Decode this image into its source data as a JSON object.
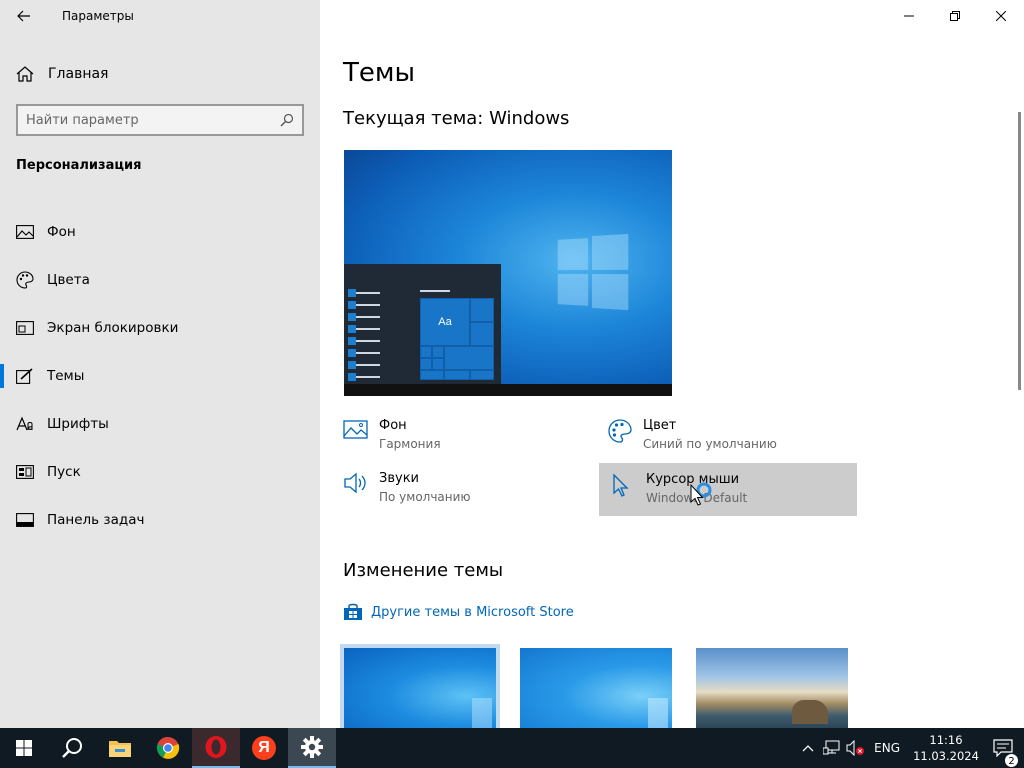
{
  "window": {
    "title": "Параметры"
  },
  "sidebar": {
    "home_label": "Главная",
    "search_placeholder": "Найти параметр",
    "section_heading": "Персонализация",
    "items": [
      {
        "label": "Фон",
        "icon": "picture-icon"
      },
      {
        "label": "Цвета",
        "icon": "palette-icon"
      },
      {
        "label": "Экран блокировки",
        "icon": "lock-screen-icon"
      },
      {
        "label": "Темы",
        "icon": "brush-icon",
        "active": true
      },
      {
        "label": "Шрифты",
        "icon": "font-icon"
      },
      {
        "label": "Пуск",
        "icon": "start-icon"
      },
      {
        "label": "Панель задач",
        "icon": "taskbar-icon"
      }
    ]
  },
  "main": {
    "page_title": "Темы",
    "current_theme": "Текущая тема: Windows",
    "preview_tile_label": "Aa",
    "settings": {
      "background": {
        "title": "Фон",
        "value": "Гармония"
      },
      "color": {
        "title": "Цвет",
        "value": "Синий по умолчанию"
      },
      "sounds": {
        "title": "Звуки",
        "value": "По умолчанию"
      },
      "cursor": {
        "title": "Курсор мыши",
        "value": "Windows Default"
      }
    },
    "change_heading": "Изменение темы",
    "store_link": "Другие темы в Microsoft Store"
  },
  "taskbar": {
    "apps": [
      "start-icon",
      "search-icon",
      "file-explorer-icon",
      "chrome-icon",
      "opera-icon",
      "yandex-icon",
      "settings-icon"
    ],
    "yandex_letter": "Я",
    "language": "ENG",
    "time": "11:16",
    "date": "11.03.2024",
    "notification_count": "2"
  },
  "colors": {
    "accent": "#0078d7",
    "sidebar_bg": "#e6e6e6",
    "taskbar_bg": "#101a22",
    "link": "#0067b8"
  }
}
